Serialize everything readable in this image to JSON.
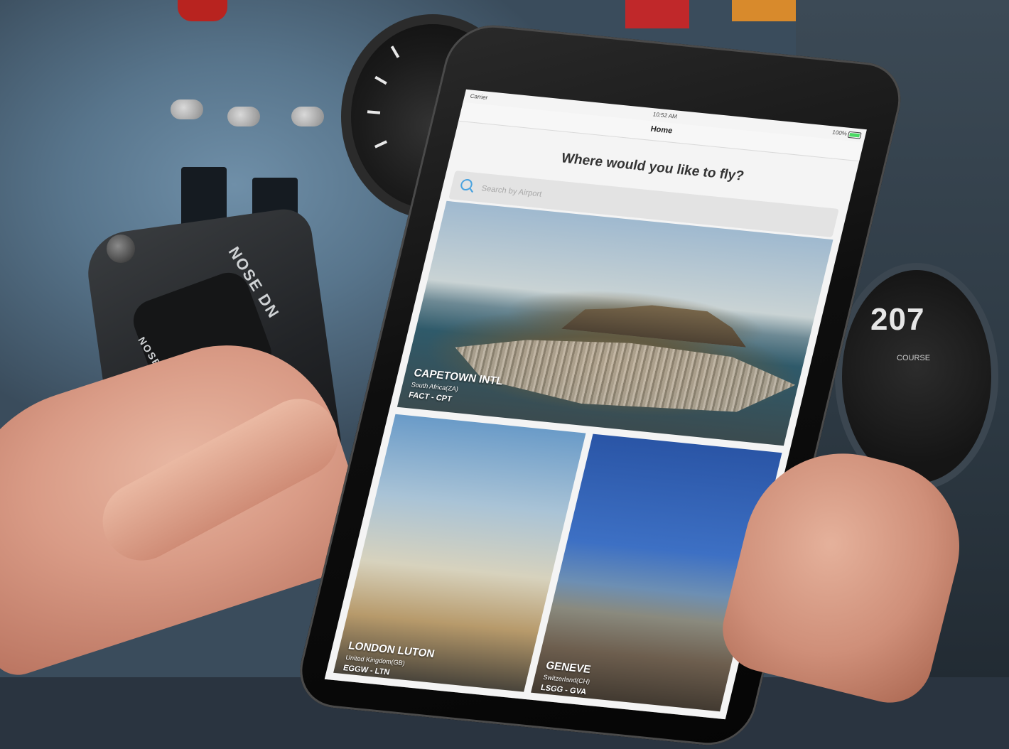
{
  "status_bar": {
    "carrier": "Carrier",
    "time": "10:52 AM",
    "battery": "100%"
  },
  "nav": {
    "title": "Home"
  },
  "headline": "Where would you like to fly?",
  "search": {
    "placeholder": "Search by Airport"
  },
  "airports": [
    {
      "name": "CAPETOWN INTL",
      "country": "South Africa(ZA)",
      "codes": "FACT - CPT"
    },
    {
      "name": "LONDON LUTON",
      "country": "United Kingdom(GB)",
      "codes": "EGGW - LTN"
    },
    {
      "name": "GENEVE",
      "country": "Switzerland(CH)",
      "codes": "LSGG - GVA"
    }
  ],
  "background": {
    "gauge_value": "207",
    "gauge_label": "COURSE",
    "yoke_label_1": "NOSE DN",
    "yoke_label_2": "NOSE UP"
  },
  "colors": {
    "accent": "#4aa3df",
    "red_button": "#c51e16"
  }
}
